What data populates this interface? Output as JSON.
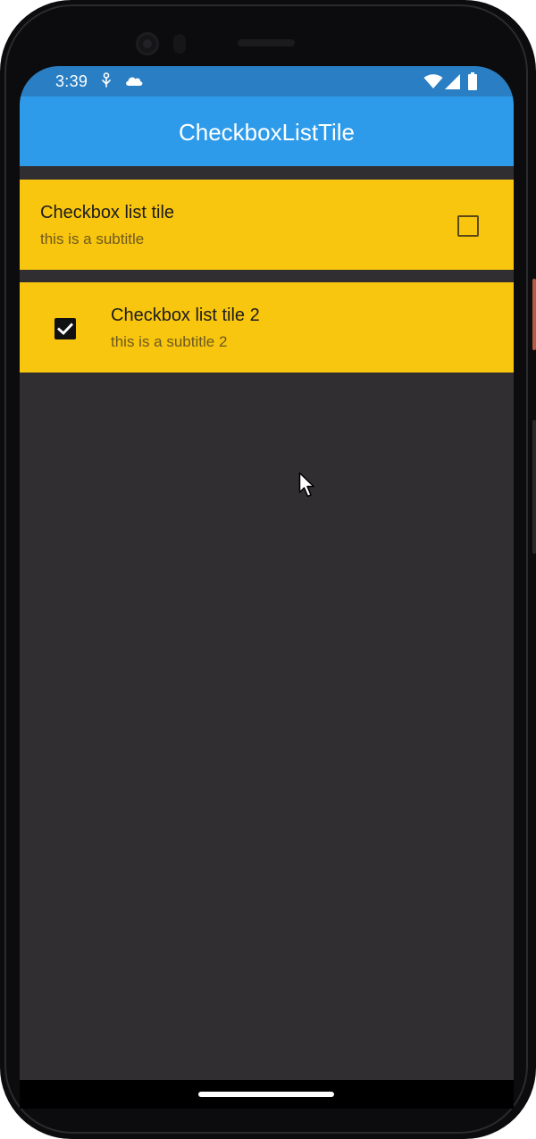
{
  "status_bar": {
    "time": "3:39",
    "left_icons": [
      "usb-debug-icon",
      "cloud-icon"
    ],
    "right_icons": [
      "wifi-icon",
      "cell-signal-icon",
      "battery-icon"
    ]
  },
  "app_bar": {
    "title": "CheckboxListTile",
    "color": "#2d9bea"
  },
  "tiles": [
    {
      "title": "Checkbox list tile",
      "subtitle": "this is a subtitle",
      "checked": false,
      "checkbox_position": "trailing"
    },
    {
      "title": "Checkbox list tile 2",
      "subtitle": "this is a subtitle 2",
      "checked": true,
      "checkbox_position": "leading"
    }
  ],
  "colors": {
    "tile_background": "#f8c50f",
    "screen_background": "#302e31",
    "status_bar": "#2a7fc4"
  }
}
